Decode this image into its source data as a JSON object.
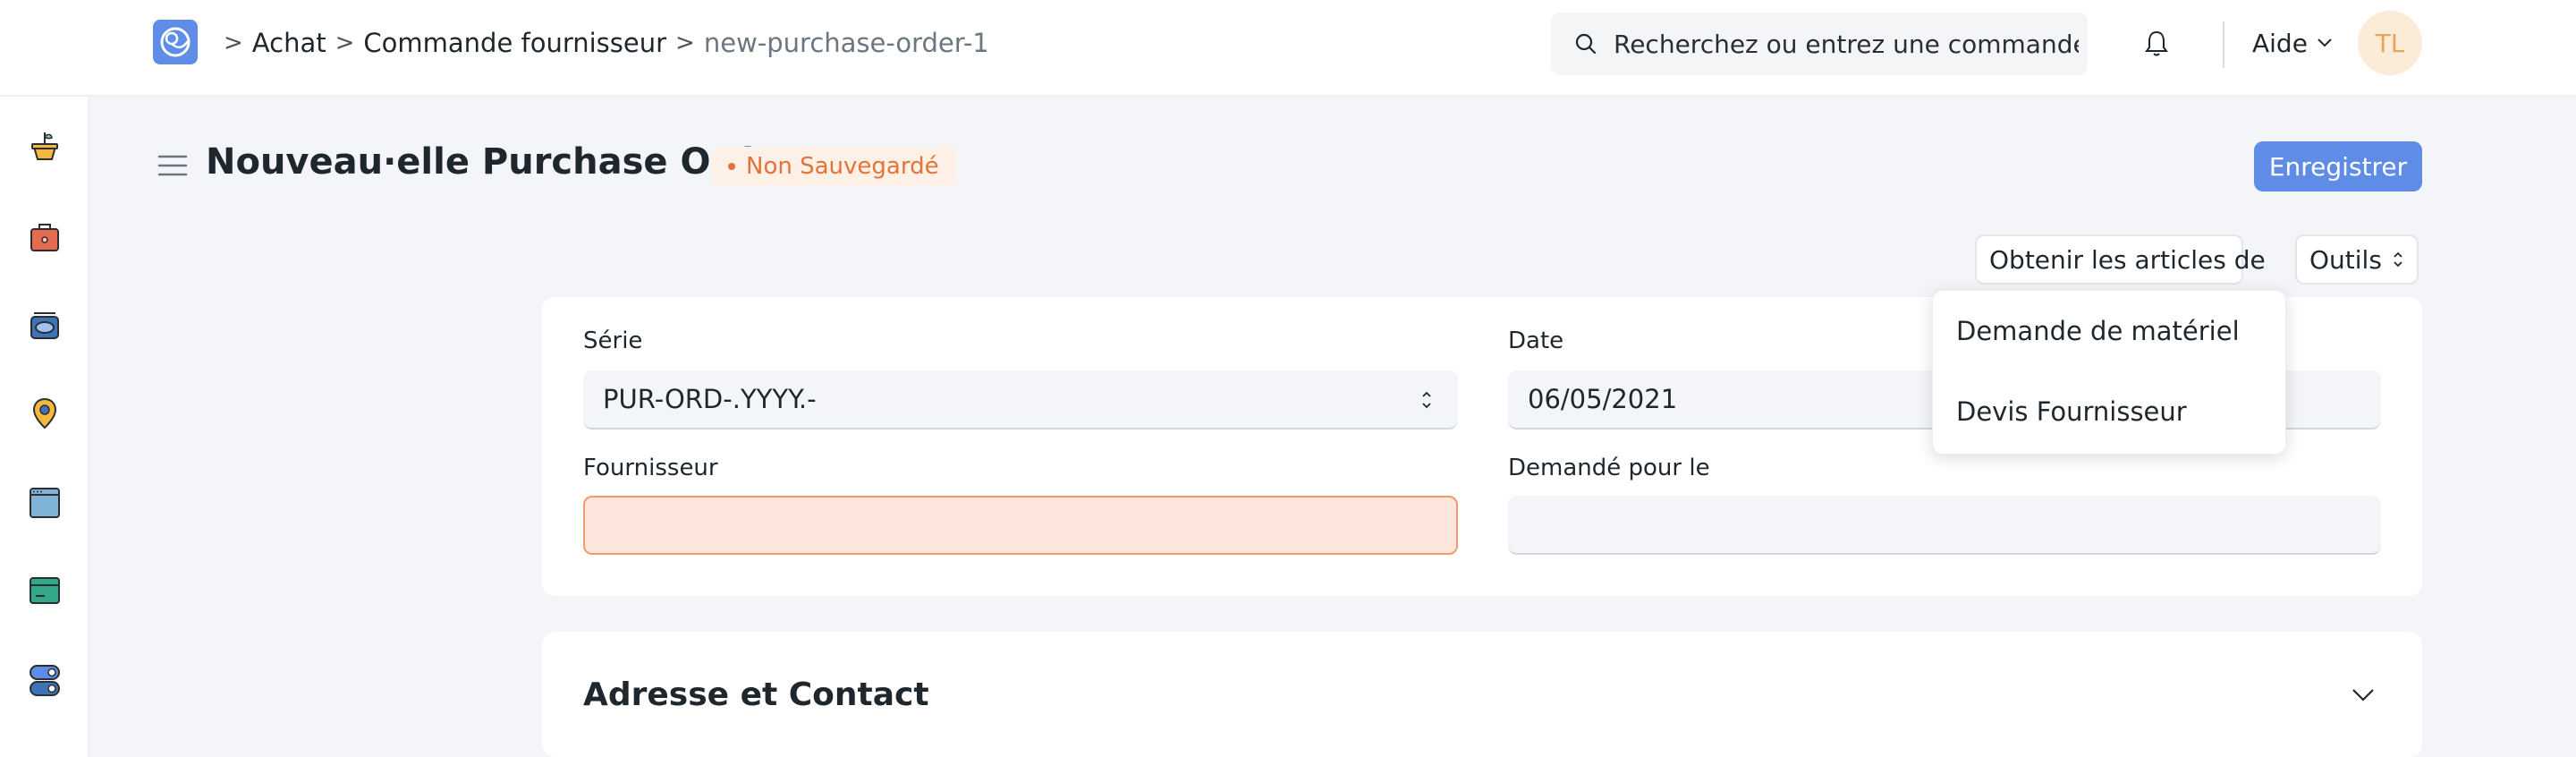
{
  "navbar": {
    "breadcrumbs": [
      "Achat",
      "Commande fournisseur",
      "new-purchase-order-1"
    ],
    "breadcrumb_separator": ">",
    "search_placeholder": "Recherchez ou entrez une commande",
    "help_label": "Aide",
    "avatar_initials": "TL"
  },
  "sidebar": {
    "icons": [
      "plant-pot-icon",
      "briefcase-icon",
      "stack-icon",
      "map-pin-icon",
      "browser-window-icon",
      "card-icon",
      "toggle-icon"
    ]
  },
  "page": {
    "title": "Nouveau·elle Purchase Order",
    "status": "Non Sauvegardé",
    "save_label": "Enregistrer",
    "get_items_label": "Obtenir les articles de",
    "tools_label": "Outils"
  },
  "form": {
    "series_label": "Série",
    "series_value": "PUR-ORD-.YYYY.-",
    "date_label": "Date",
    "date_value": "06/05/2021",
    "supplier_label": "Fournisseur",
    "supplier_value": "",
    "required_by_label": "Demandé pour le",
    "required_by_value": ""
  },
  "dropdown": {
    "items": [
      "Demande de matériel",
      "Devis Fournisseur"
    ]
  },
  "section": {
    "title": "Adresse et Contact"
  },
  "colors": {
    "primary": "#5e8ce6",
    "warning": "#e2743a",
    "error_bg": "#fde7dd",
    "error_border": "#f19a6c",
    "page_bg": "#f4f5f8"
  }
}
